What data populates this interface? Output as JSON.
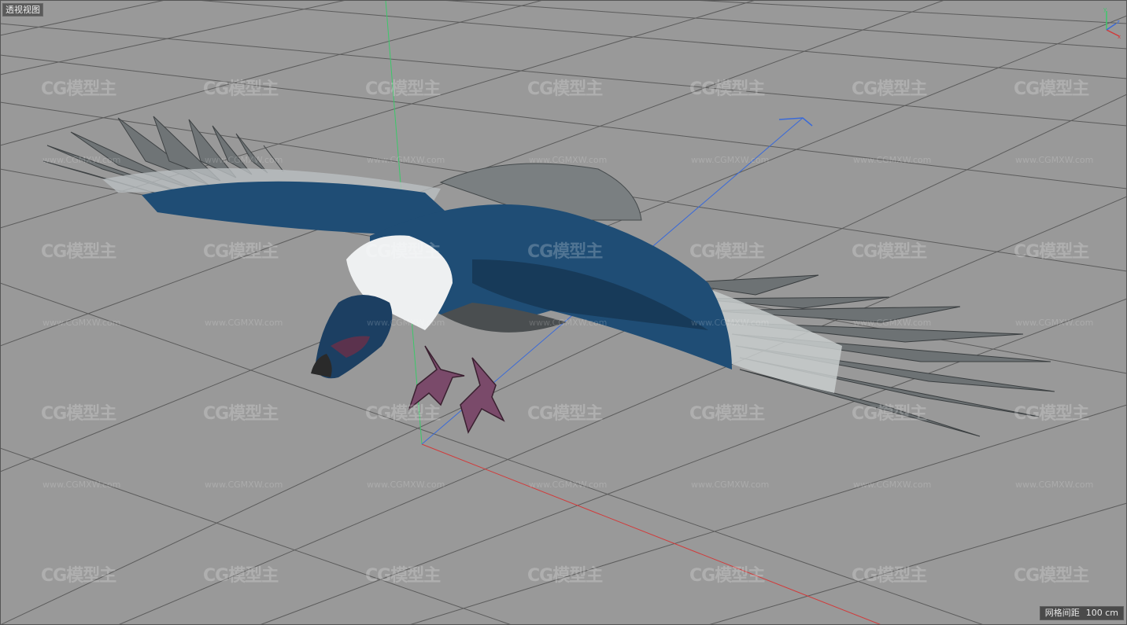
{
  "viewport": {
    "view_name": "透视视图",
    "grid_spacing_label": "网格间距",
    "grid_spacing_value": "100 cm"
  },
  "watermark": {
    "logo_text": "CG模型主",
    "url_text": "www.CGMXW.com"
  },
  "colors": {
    "viewport_bg": "#999999",
    "grid_line": "#5a5a5a",
    "axis_x": "#d23a3a",
    "axis_y": "#3cc86a",
    "axis_z": "#3a6ad8",
    "bird_body": "#1f4d75",
    "feather_grey": "#6f7476",
    "ruff_white": "#f0f0f0",
    "feet": "#7a4a6a"
  },
  "icons": {
    "axis_gizmo": "axis-gizmo-icon"
  }
}
